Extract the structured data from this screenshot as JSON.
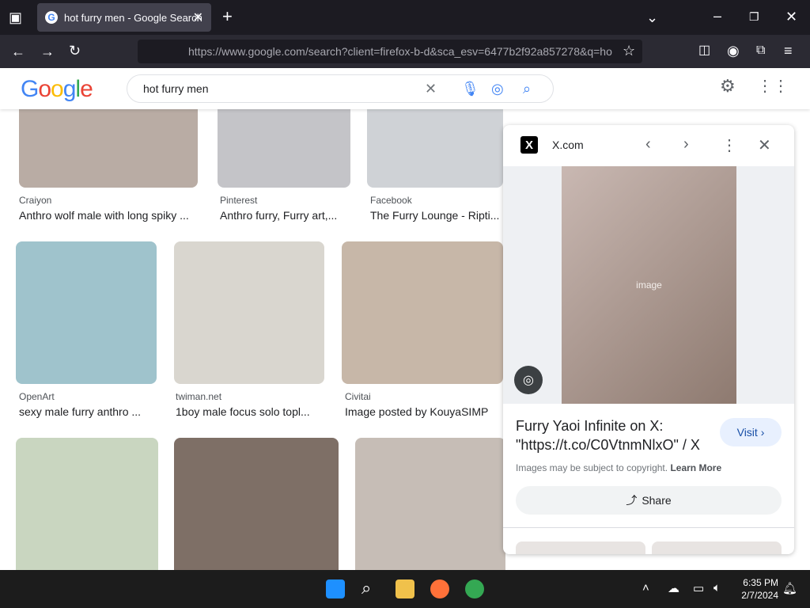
{
  "browser": {
    "tab_title": "hot furry men - Google Search",
    "url_host": "https://www.google.com",
    "url_rest": "/search?client=firefox-b-d&sca_esv=6477b2f92a857278&q=ho",
    "new_tab": "+"
  },
  "google": {
    "logo": [
      "G",
      "o",
      "o",
      "g",
      "l",
      "e"
    ],
    "query": "hot furry men"
  },
  "results": [
    {
      "source": "Craiyon",
      "caption": "Anthro wolf male with long spiky ..."
    },
    {
      "source": "Pinterest",
      "caption": "Anthro furry, Furry art,..."
    },
    {
      "source": "Facebook",
      "caption": "The Furry Lounge - Ripti..."
    },
    {
      "source": "OpenArt",
      "caption": "sexy male furry anthro ..."
    },
    {
      "source": "twiman.net",
      "caption": "1boy male focus solo topl..."
    },
    {
      "source": "Civitai",
      "caption": "Image posted by KouyaSIMP"
    }
  ],
  "panel": {
    "host": "X.com",
    "title": "Furry Yaoi Infinite on X: \"https://t.co/C0VtnmNlxO\" / X",
    "visit": "Visit",
    "copyright": "Images may be subject to copyright.",
    "learn_more": "Learn More",
    "share": "Share",
    "image_placeholder": "image"
  },
  "taskbar": {
    "time": "6:35 PM",
    "date": "2/7/2024"
  },
  "colors": {
    "accent": "#1a73e8",
    "chrome_dark": "#1c1b22"
  }
}
